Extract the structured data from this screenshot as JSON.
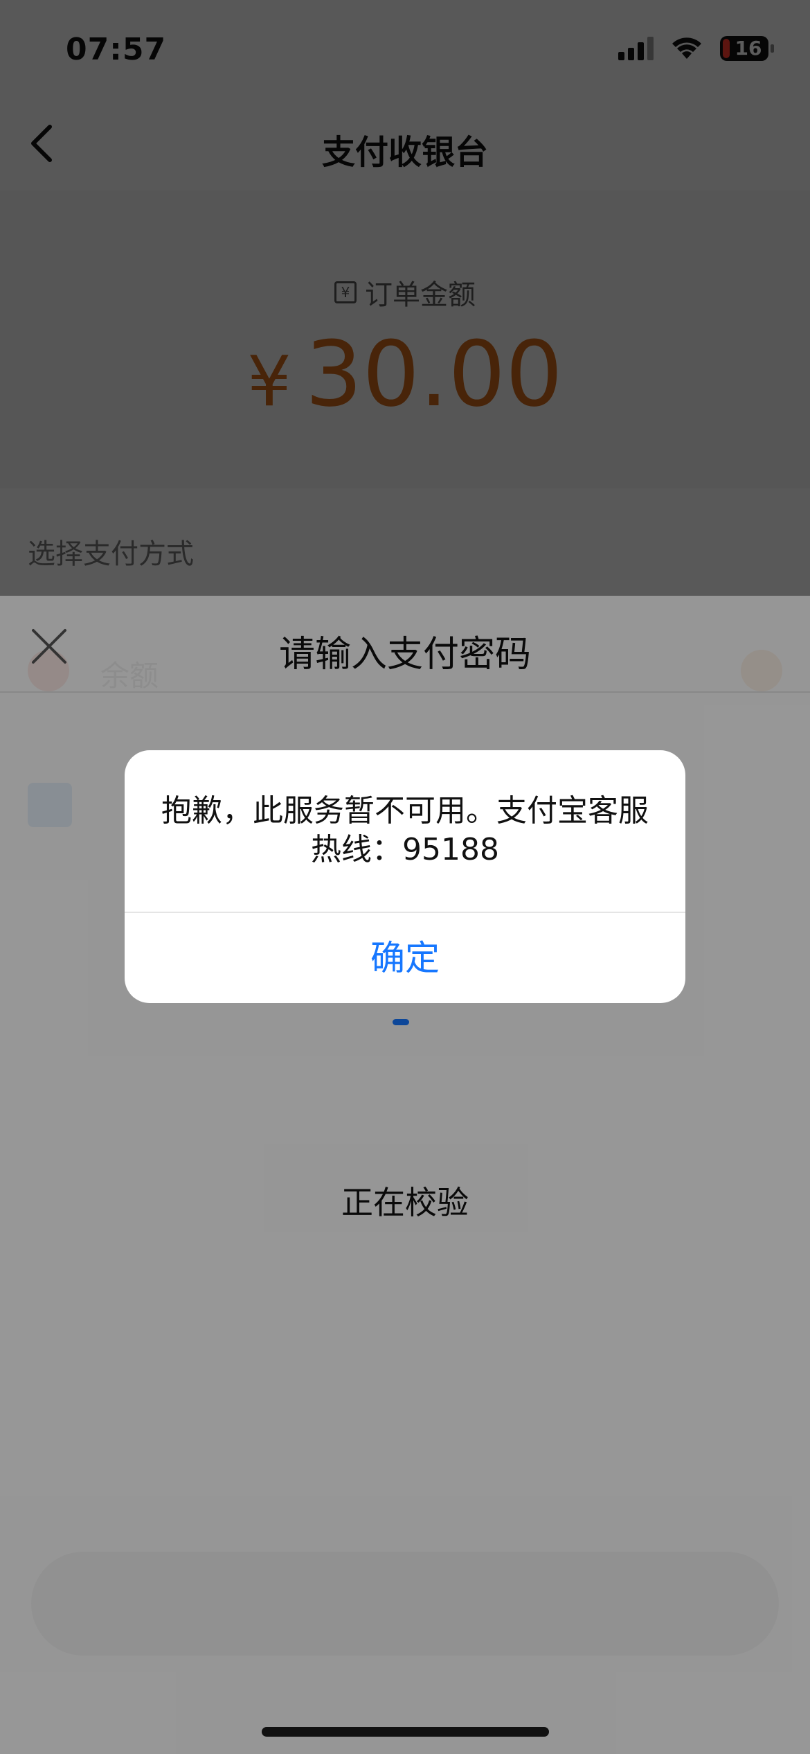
{
  "status_bar": {
    "time": "07:57",
    "battery": "16",
    "icons": [
      "signal-icon",
      "wifi-icon",
      "battery-icon"
    ]
  },
  "nav": {
    "title": "支付收银台",
    "back_icon": "chevron-left-icon"
  },
  "order": {
    "label": "订单金额",
    "currency_symbol": "¥",
    "amount": "30.00",
    "label_icon": "yuan-receipt-icon"
  },
  "payment_method": {
    "section_label": "选择支付方式"
  },
  "password_sheet": {
    "title": "请输入支付密码",
    "close_icon": "close-icon",
    "status_text": "正在校验"
  },
  "alert": {
    "message": "抱歉，此服务暂不可用。支付宝客服热线：95188",
    "confirm_label": "确定"
  },
  "colors": {
    "accent_blue": "#1677ff",
    "amount_orange": "#c8671a"
  }
}
